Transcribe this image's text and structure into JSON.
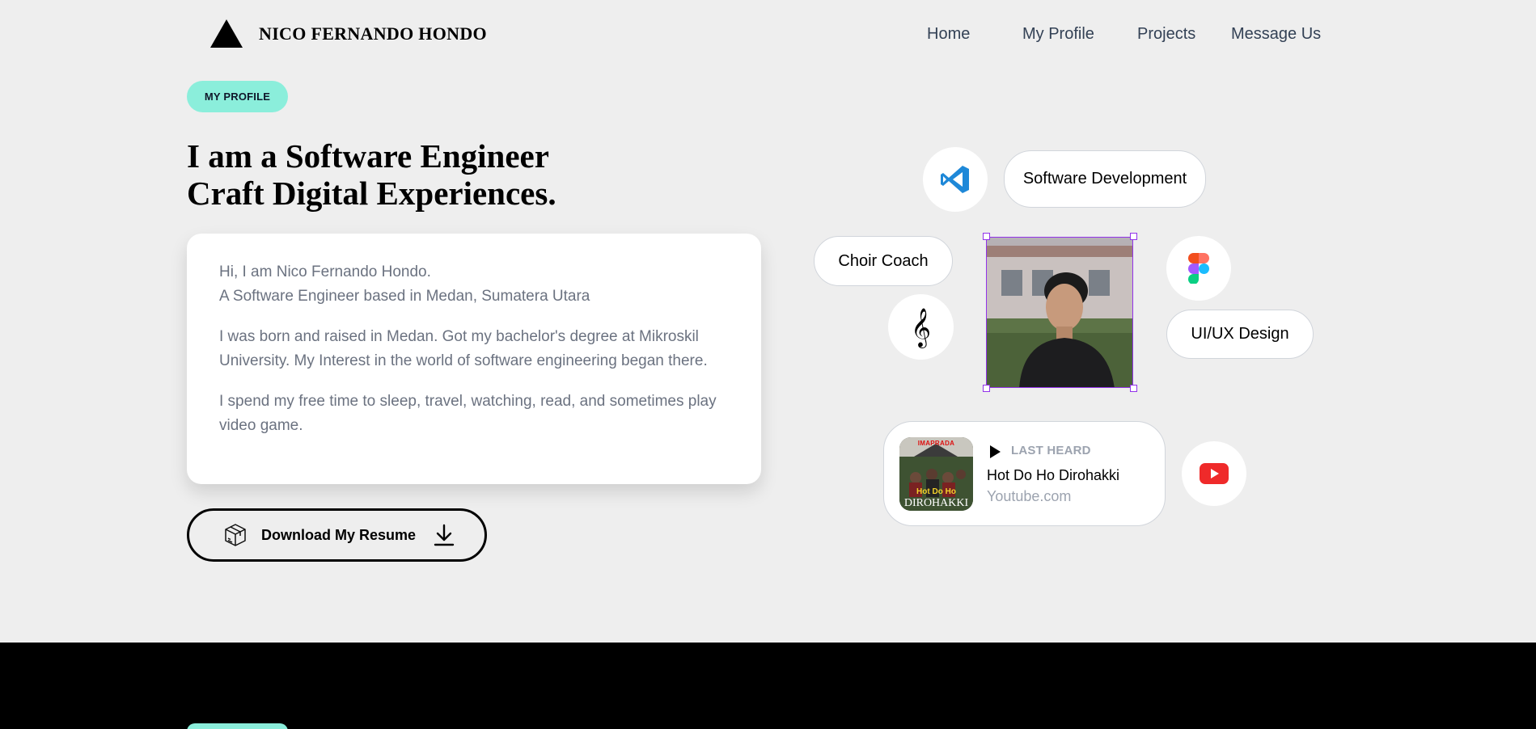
{
  "header": {
    "brand_name": "NICO FERNANDO HONDO",
    "nav": [
      "Home",
      "My Profile",
      "Projects",
      "Message Us"
    ]
  },
  "hero": {
    "badge": "MY PROFILE",
    "headline_line1": "I am a Software Engineer",
    "headline_line2": "Craft Digital Experiences."
  },
  "about": {
    "intro_line1": "Hi, I am Nico Fernando Hondo.",
    "intro_line2": "A Software Engineer based in Medan, Sumatera Utara",
    "para2": "I was born and raised in Medan. Got my bachelor's degree at Mikroskil University. My Interest in the world of software engineering began there.",
    "para3": "I spend my free time to sleep, travel, watching, read, and sometimes play video game."
  },
  "resume_button": {
    "label": "Download My Resume"
  },
  "skills": {
    "software_development": "Software Development",
    "choir_coach": "Choir Coach",
    "uiux_design": "UI/UX Design"
  },
  "icons": {
    "vscode": "vscode-icon",
    "figma": "figma-icon",
    "music": "treble-clef-icon",
    "youtube": "youtube-icon"
  },
  "last_heard": {
    "label": "LAST HEARD",
    "title": "Hot Do Ho Dirohakki",
    "source": "Youtube.com",
    "thumb_top_text": "IMAPRADA",
    "thumb_mid_text": "Hot Do Ho",
    "thumb_bottom_text": "DIROHAKKI"
  },
  "colors": {
    "accent": "#8beedb",
    "background": "#eeeeee",
    "selection": "#9333ea",
    "youtube_red": "#ef2a2a",
    "vscode_blue": "#1e88d8"
  }
}
